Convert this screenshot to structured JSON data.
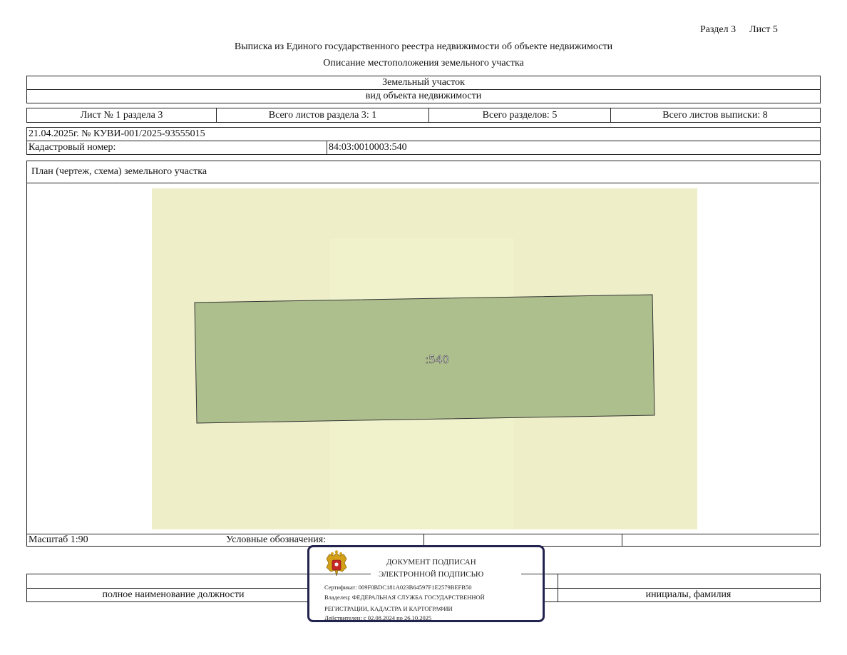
{
  "header": {
    "section": "Раздел 3",
    "sheet": "Лист 5",
    "title": "Выписка из Единого государственного реестра недвижимости об объекте недвижимости",
    "subtitle": "Описание местоположения земельного участка"
  },
  "object": {
    "type": "Земельный участок",
    "type_caption": "вид объекта недвижимости"
  },
  "sheet_info": {
    "sheet_no": "Лист № 1 раздела 3",
    "total_sheets_section": "Всего листов раздела 3: 1",
    "total_sections": "Всего разделов: 5",
    "total_sheets_extract": "Всего листов выписки: 8"
  },
  "record": {
    "date_number": "21.04.2025г. № КУВИ-001/2025-93555015",
    "cadastral_label": "Кадастровый номер:",
    "cadastral_value": "84:03:0010003:540"
  },
  "plan": {
    "title": "План (чертеж, схема) земельного участка",
    "parcel_label": ":540",
    "colors": {
      "background": "#eeefc9",
      "parcel_fill": "#aebf8e",
      "parcel_stroke": "#333333"
    }
  },
  "footer": {
    "scale": "Масштаб 1:90",
    "legend_label": "Условные обозначения:",
    "position_caption": "полное наименование должности",
    "name_caption": "инициалы, фамилия"
  },
  "signature_stamp": {
    "line1": "ДОКУМЕНТ ПОДПИСАН",
    "line2": "ЭЛЕКТРОННОЙ ПОДПИСЬЮ",
    "certificate": "Сертификат: 009F0BDC181A023B64597F1E2579BEFB50",
    "owner_line1": "Владелец: ФЕДЕРАЛЬНАЯ СЛУЖБА ГОСУДАРСТВЕННОЙ",
    "owner_line2": "РЕГИСТРАЦИИ, КАДАСТРА И КАРТОГРАФИИ",
    "validity": "Действителен: с 02.08.2024 по 26.10.2025",
    "emblem_icon": "coat-of-arms-icon"
  }
}
